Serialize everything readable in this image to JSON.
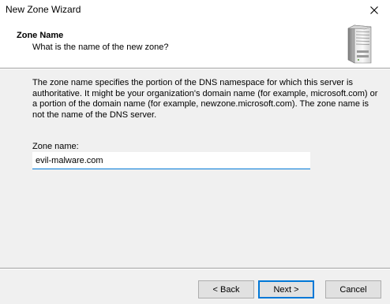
{
  "window": {
    "title": "New Zone Wizard",
    "close_icon": "close-icon"
  },
  "header": {
    "title": "Zone Name",
    "subtitle": "What is the name of the new zone?",
    "icon": "server-tower-icon"
  },
  "body": {
    "description": "The zone name specifies the portion of the DNS namespace for which this server is authoritative. It might be your organization's domain name (for example,  microsoft.com) or a portion of the domain name (for example, newzone.microsoft.com). The zone name is not the name of the DNS server.",
    "zone_name_label": "Zone name:",
    "zone_name_value": "evil-malware.com"
  },
  "buttons": {
    "back": "< Back",
    "next": "Next >",
    "cancel": "Cancel"
  },
  "colors": {
    "focus_accent": "#0078d7",
    "dialog_background": "#f0f0f0",
    "header_background": "#ffffff"
  }
}
